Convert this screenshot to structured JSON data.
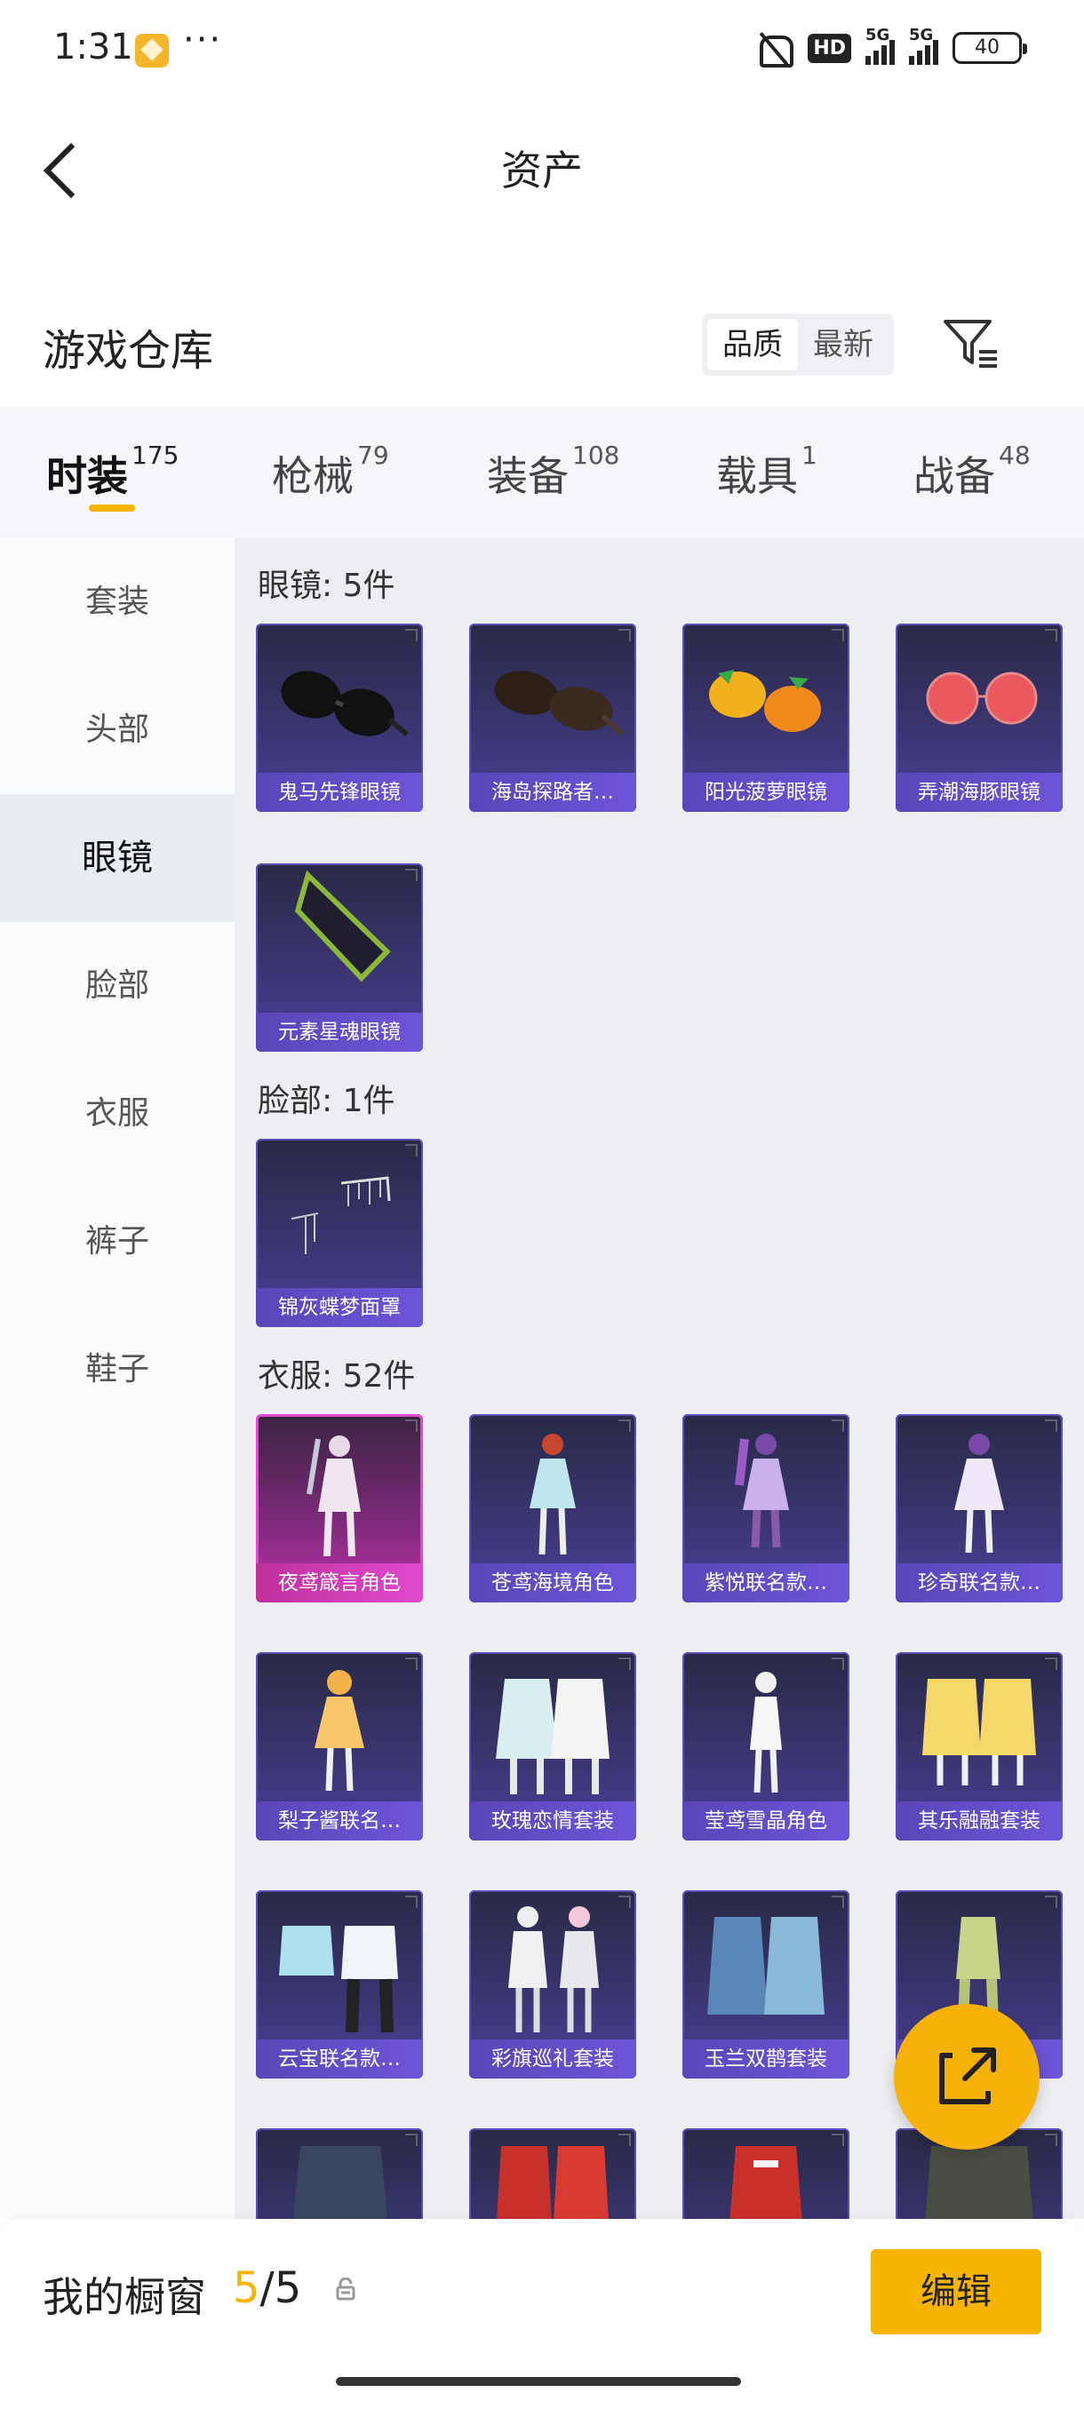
{
  "status_bar": {
    "time": "1:31",
    "dots": "···",
    "hd": "HD",
    "net1": "5G",
    "net2": "5G",
    "battery": "40"
  },
  "header": {
    "title": "资产"
  },
  "warehouse": {
    "title": "游戏仓库",
    "sort_quality": "品质",
    "sort_newest": "最新"
  },
  "tabs": [
    {
      "label": "时装",
      "count": "175"
    },
    {
      "label": "枪械",
      "count": "79"
    },
    {
      "label": "装备",
      "count": "108"
    },
    {
      "label": "载具",
      "count": "1"
    },
    {
      "label": "战备",
      "count": "48"
    }
  ],
  "sidebar": {
    "items": [
      "套装",
      "头部",
      "眼镜",
      "脸部",
      "衣服",
      "裤子",
      "鞋子"
    ],
    "active_index": 2
  },
  "sections": {
    "glasses": {
      "title": "眼镜: 5件",
      "items": [
        "鬼马先锋眼镜",
        "海岛探路者…",
        "阳光菠萝眼镜",
        "弄潮海豚眼镜",
        "元素星魂眼镜"
      ]
    },
    "face": {
      "title": "脸部: 1件",
      "items": [
        "锦灰蝶梦面罩"
      ]
    },
    "clothes": {
      "title": "衣服: 52件",
      "items": [
        "夜鸢箴言角色",
        "苍鸢海境角色",
        "紫悦联名款…",
        "珍奇联名款…",
        "梨子酱联名…",
        "玫瑰恋情套装",
        "莹鸢雪晶角色",
        "其乐融融套装",
        "云宝联名款…",
        "彩旗巡礼套装",
        "玉兰双鹊套装",
        "",
        "",
        "",
        "",
        ""
      ]
    }
  },
  "bottom_bar": {
    "label": "我的橱窗",
    "count_current": "5",
    "count_total": "/5",
    "edit_label": "编辑"
  },
  "colors": {
    "accent": "#f7b400",
    "card_purple": "#4a3f98",
    "card_pink": "#c02fa8"
  }
}
